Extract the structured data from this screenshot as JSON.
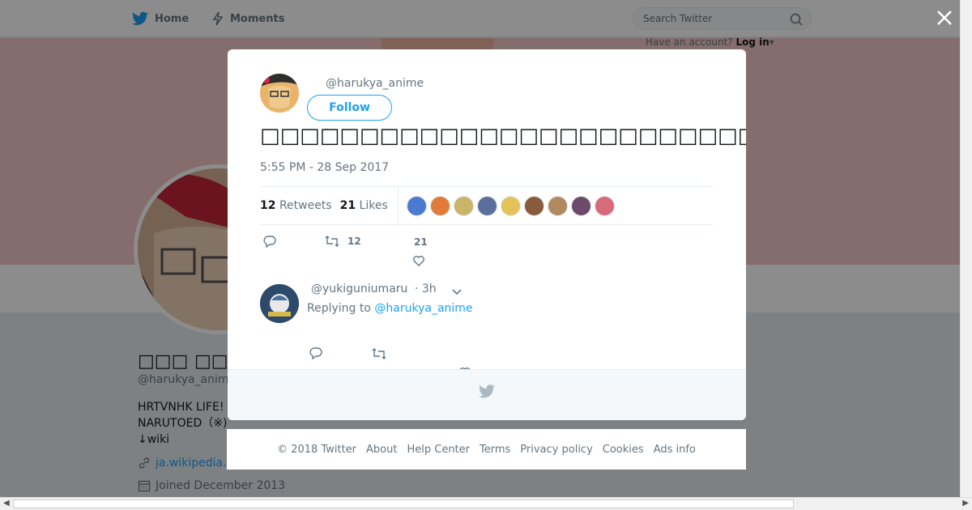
{
  "topbar": {
    "home_label": "Home",
    "moments_label": "Moments",
    "search_placeholder": "Search Twitter",
    "have_account": "Have an account?",
    "login_label": "Log in"
  },
  "profile": {
    "name": "□□□ □□",
    "handle": "@harukya_anime",
    "bio_line1": "HRTVNHK LIFE!",
    "bio_line2": "NARUTOED（※)",
    "bio_line3": "↓wiki",
    "link": "ja.wikipedia.",
    "joined": "Joined December 2013"
  },
  "tweet": {
    "handle": "@harukya_anime",
    "follow_label": "Follow",
    "text": "□□□□□□□□□□□□□□□□□□□□□□□□□□□□□□□□□□□□□□□□KADOKAWA□□□□□□□□□□□□",
    "timestamp": "5:55 PM - 28 Sep 2017",
    "retweets_count": "12",
    "retweets_label": "Retweets",
    "likes_count": "21",
    "likes_label": "Likes",
    "likers_colors": [
      "#4a7bd0",
      "#e07b39",
      "#c9b46a",
      "#5b6e9c",
      "#e3c25a",
      "#8a5a3c",
      "#b08a5e",
      "#6d4a6a",
      "#d96a7a"
    ],
    "action_retweet_count": "12",
    "action_like_count": "21"
  },
  "reply": {
    "handle": "@yukiguniumaru",
    "time": "· 3h",
    "replying_prefix": "Replying to",
    "replying_handle": "@harukya_anime"
  },
  "footer": {
    "links": [
      "© 2018 Twitter",
      "About",
      "Help Center",
      "Terms",
      "Privacy policy",
      "Cookies",
      "Ads info"
    ]
  },
  "colors": {
    "accent": "#1da1f2",
    "banner": "#f3c6c6"
  }
}
